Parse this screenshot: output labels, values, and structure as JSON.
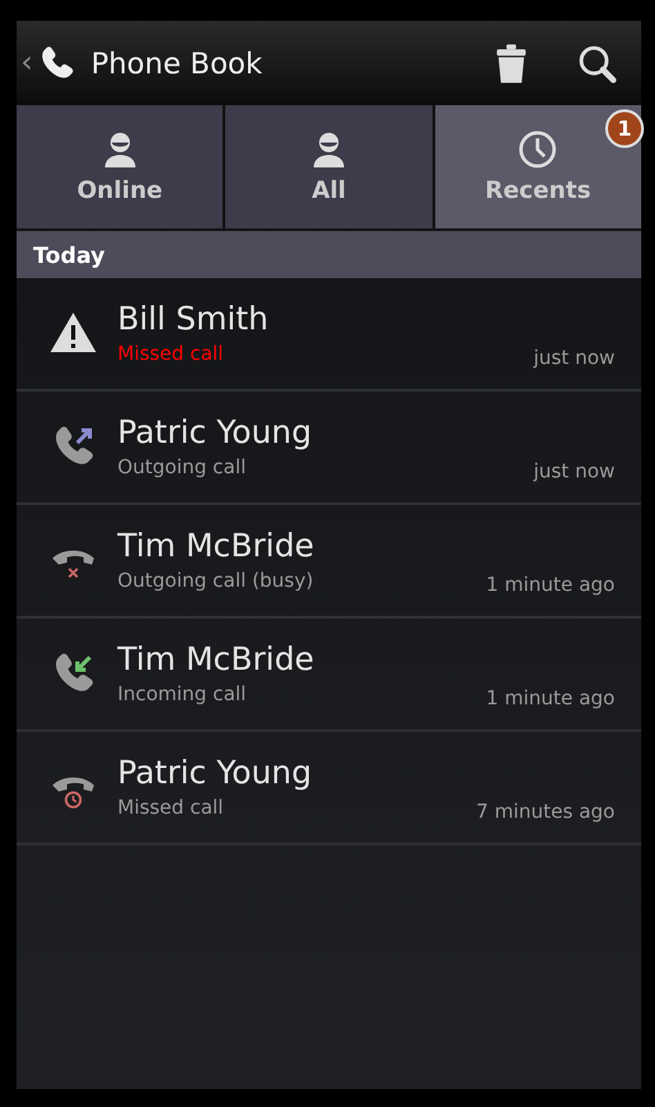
{
  "header": {
    "back": "‹",
    "title": "Phone Book"
  },
  "tabs": [
    {
      "label": "Online",
      "kind": "person",
      "selected": false
    },
    {
      "label": "All",
      "kind": "person",
      "selected": false
    },
    {
      "label": "Recents",
      "kind": "clock",
      "selected": true,
      "badge": "1"
    }
  ],
  "section": {
    "title": "Today"
  },
  "calls": [
    {
      "kind": "alert",
      "name": "Bill Smith",
      "status": "Missed call",
      "urgent": true,
      "time": "just now"
    },
    {
      "kind": "outgoing",
      "name": "Patric Young",
      "status": "Outgoing call",
      "urgent": false,
      "time": "just now"
    },
    {
      "kind": "busy",
      "name": "Tim McBride",
      "status": "Outgoing call (busy)",
      "urgent": false,
      "time": "1 minute ago"
    },
    {
      "kind": "incoming",
      "name": "Tim McBride",
      "status": "Incoming call",
      "urgent": false,
      "time": "1 minute ago"
    },
    {
      "kind": "missed",
      "name": "Patric Young",
      "status": "Missed call",
      "urgent": false,
      "time": "7 minutes ago"
    }
  ]
}
